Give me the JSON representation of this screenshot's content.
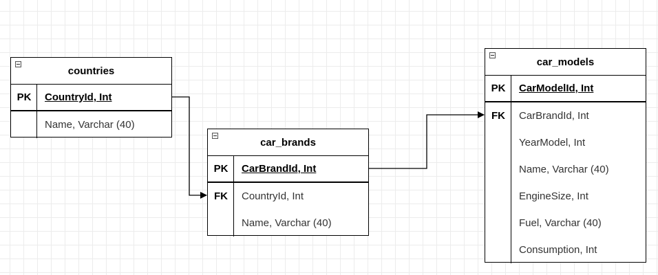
{
  "diagram": {
    "entities": [
      {
        "id": "countries",
        "title": "countries",
        "rows": [
          {
            "key": "PK",
            "field": "CountryId, Int"
          },
          {
            "key": "",
            "field": "Name, Varchar (40)"
          }
        ]
      },
      {
        "id": "car_brands",
        "title": "car_brands",
        "rows": [
          {
            "key": "PK",
            "field": "CarBrandId, Int"
          },
          {
            "key": "FK",
            "field": "CountryId, Int"
          },
          {
            "key": "",
            "field": "Name, Varchar (40)"
          }
        ]
      },
      {
        "id": "car_models",
        "title": "car_models",
        "rows": [
          {
            "key": "PK",
            "field": "CarModelId, Int"
          },
          {
            "key": "FK",
            "field": "CarBrandId, Int"
          },
          {
            "key": "",
            "field": "YearModel, Int"
          },
          {
            "key": "",
            "field": "Name, Varchar (40)"
          },
          {
            "key": "",
            "field": "EngineSize, Int"
          },
          {
            "key": "",
            "field": "Fuel, Varchar (40)"
          },
          {
            "key": "",
            "field": "Consumption, Int"
          }
        ]
      }
    ],
    "relationships": [
      {
        "from": "countries.CountryId",
        "to": "car_brands.CountryId"
      },
      {
        "from": "car_brands.CarBrandId",
        "to": "car_models.CarBrandId"
      }
    ],
    "colors": {
      "stroke": "#000000",
      "grid": "#ececec",
      "field_text": "#333333"
    }
  }
}
